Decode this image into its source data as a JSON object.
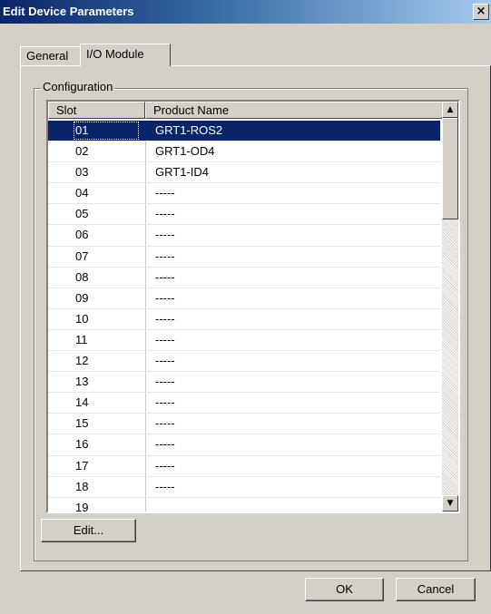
{
  "window": {
    "title": "Edit Device Parameters",
    "close_glyph": "×"
  },
  "tabs": [
    {
      "label": "General"
    },
    {
      "label": "I/O Module"
    }
  ],
  "group": {
    "label": "Configuration"
  },
  "table": {
    "columns": [
      "Slot",
      "Product Name"
    ],
    "rows": [
      {
        "slot": "01",
        "name": "GRT1-ROS2"
      },
      {
        "slot": "02",
        "name": "GRT1-OD4"
      },
      {
        "slot": "03",
        "name": "GRT1-ID4"
      },
      {
        "slot": "04",
        "name": "-----"
      },
      {
        "slot": "05",
        "name": "-----"
      },
      {
        "slot": "06",
        "name": "-----"
      },
      {
        "slot": "07",
        "name": "-----"
      },
      {
        "slot": "08",
        "name": "-----"
      },
      {
        "slot": "09",
        "name": "-----"
      },
      {
        "slot": "10",
        "name": "-----"
      },
      {
        "slot": "11",
        "name": "-----"
      },
      {
        "slot": "12",
        "name": "-----"
      },
      {
        "slot": "13",
        "name": "-----"
      },
      {
        "slot": "14",
        "name": "-----"
      },
      {
        "slot": "15",
        "name": "-----"
      },
      {
        "slot": "16",
        "name": "-----"
      },
      {
        "slot": "17",
        "name": "-----"
      },
      {
        "slot": "18",
        "name": "-----"
      },
      {
        "slot": "19",
        "name": ""
      }
    ],
    "selected_row": 0
  },
  "buttons": {
    "edit": "Edit...",
    "ok": "OK",
    "cancel": "Cancel"
  }
}
